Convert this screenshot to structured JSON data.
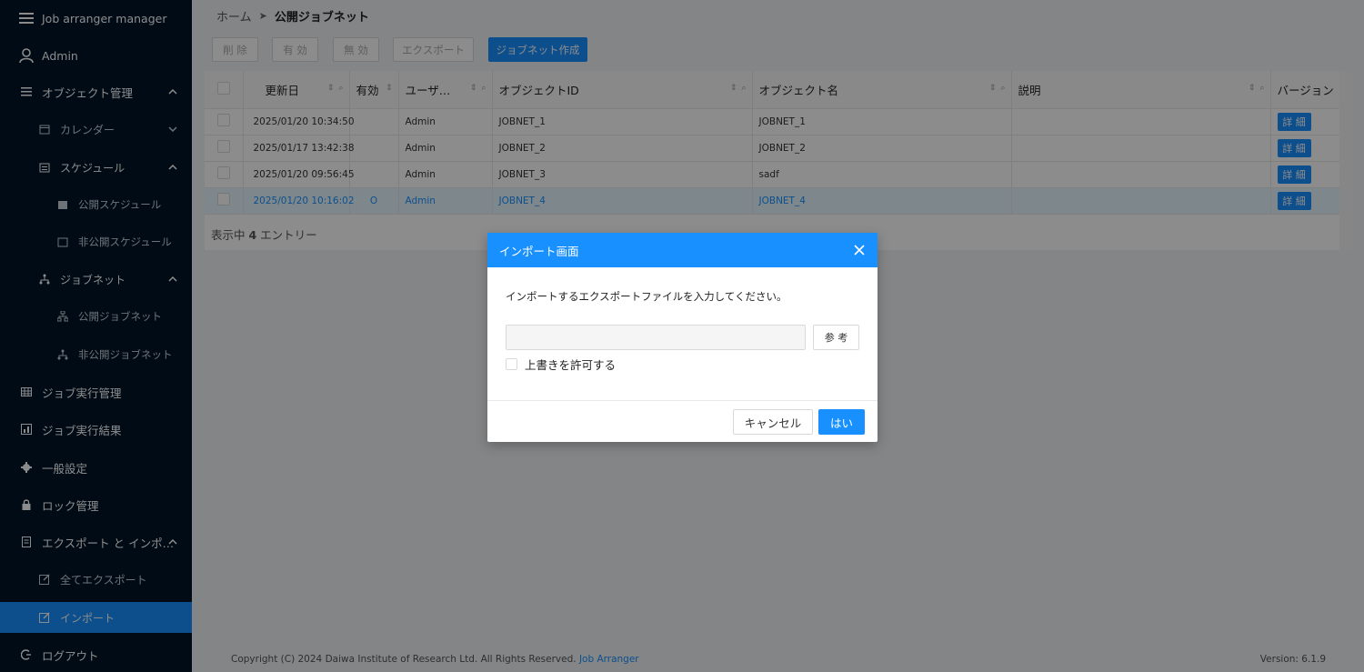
{
  "sidebar": {
    "app_title": "Job arranger manager",
    "user": "Admin",
    "items": [
      {
        "label": "オブジェクト管理"
      },
      {
        "label": "カレンダー"
      },
      {
        "label": "スケジュール"
      },
      {
        "label": "公開スケジュール"
      },
      {
        "label": "非公開スケジュール"
      },
      {
        "label": "ジョブネット"
      },
      {
        "label": "公開ジョブネット"
      },
      {
        "label": "非公開ジョブネット"
      },
      {
        "label": "ジョブ実行管理"
      },
      {
        "label": "ジョブ実行結果"
      },
      {
        "label": "一般設定"
      },
      {
        "label": "ロック管理"
      },
      {
        "label": "エクスポート と インポ…"
      },
      {
        "label": "全てエクスポート"
      },
      {
        "label": "インポート"
      },
      {
        "label": "ログアウト"
      }
    ]
  },
  "breadcrumb": {
    "home": "ホーム",
    "separator": "➤",
    "current": "公開ジョブネット"
  },
  "toolbar": {
    "delete": "削 除",
    "enable": "有 効",
    "disable": "無 効",
    "export": "エクスポート",
    "create": "ジョブネット作成"
  },
  "table": {
    "headers": [
      "更新日",
      "有効",
      "ユーザ…",
      "オブジェクトID",
      "オブジェクト名",
      "説明",
      "バージョン"
    ],
    "rows": [
      {
        "updated": "2025/01/20 10:34:50",
        "valid": "",
        "user": "Admin",
        "id": "JOBNET_1",
        "name": "JOBNET_1",
        "desc": "",
        "detail": "詳 細"
      },
      {
        "updated": "2025/01/17 13:42:38",
        "valid": "",
        "user": "Admin",
        "id": "JOBNET_2",
        "name": "JOBNET_2",
        "desc": "",
        "detail": "詳 細"
      },
      {
        "updated": "2025/01/20 09:56:45",
        "valid": "",
        "user": "Admin",
        "id": "JOBNET_3",
        "name": "sadf",
        "desc": "",
        "detail": "詳 細"
      },
      {
        "updated": "2025/01/20 10:16:02",
        "valid": "O",
        "user": "Admin",
        "id": "JOBNET_4",
        "name": "JOBNET_4",
        "desc": "",
        "detail": "詳 細"
      }
    ],
    "entries_prefix": "表示中 ",
    "entries_count": "4",
    "entries_suffix": " エントリー"
  },
  "footer": {
    "copyright": "Copyright (C) 2024 Daiwa Institute of Research Ltd. All Rights Reserved.",
    "link": "Job Arranger",
    "version": "Version: 6.1.9"
  },
  "modal": {
    "title": "インポート画面",
    "message": "インポートするエクスポートファイルを入力してください。",
    "file_value": "",
    "browse": "参 考",
    "overwrite": "上書きを許可する",
    "cancel": "キャンセル",
    "ok": "はい"
  },
  "colors": {
    "primary": "#1890ff",
    "sidebar": "#001529",
    "selected_row": "#e6f7ff"
  }
}
